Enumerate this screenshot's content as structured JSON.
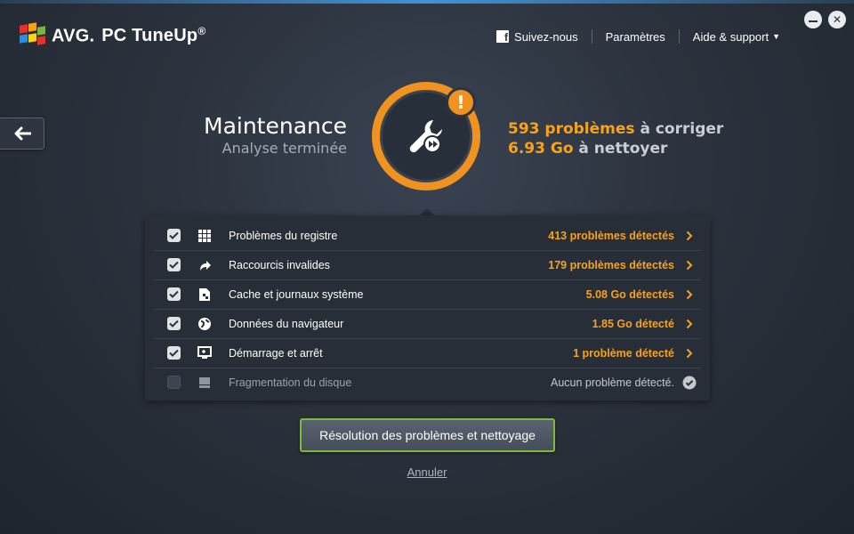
{
  "app": {
    "brand": "AVG.",
    "product": "PC TuneUp",
    "trademark": "®"
  },
  "header": {
    "follow": "Suivez-nous",
    "settings": "Paramètres",
    "help": "Aide & support"
  },
  "summary": {
    "title": "Maintenance",
    "subtitle": "Analyse terminée",
    "problems_count": "593 problèmes",
    "problems_suffix": " à corriger",
    "clean_size": "6.93 Go",
    "clean_suffix": " à nettoyer"
  },
  "items": [
    {
      "label": "Problèmes du registre",
      "value": "413 problèmes détectés",
      "checked": true,
      "icon": "grid-icon"
    },
    {
      "label": "Raccourcis invalides",
      "value": "179 problèmes détectés",
      "checked": true,
      "icon": "shortcut-arrow-icon"
    },
    {
      "label": "Cache et journaux système",
      "value": "5.08 Go détectés",
      "checked": true,
      "icon": "document-icon"
    },
    {
      "label": "Données du navigateur",
      "value": "1.85 Go détecté",
      "checked": true,
      "icon": "globe-icon"
    },
    {
      "label": "Démarrage et arrêt",
      "value": "1 problème détecté",
      "checked": true,
      "icon": "monitor-icon"
    },
    {
      "label": "Fragmentation du disque",
      "value": "Aucun problème détecté.",
      "checked": false,
      "icon": "disk-icon"
    }
  ],
  "actions": {
    "fix": "Résolution des problèmes et nettoyage",
    "cancel": "Annuler"
  },
  "colors": {
    "accent": "#f0921f",
    "highlight_text": "#f7a21b",
    "button_border": "#7dbb3c"
  }
}
